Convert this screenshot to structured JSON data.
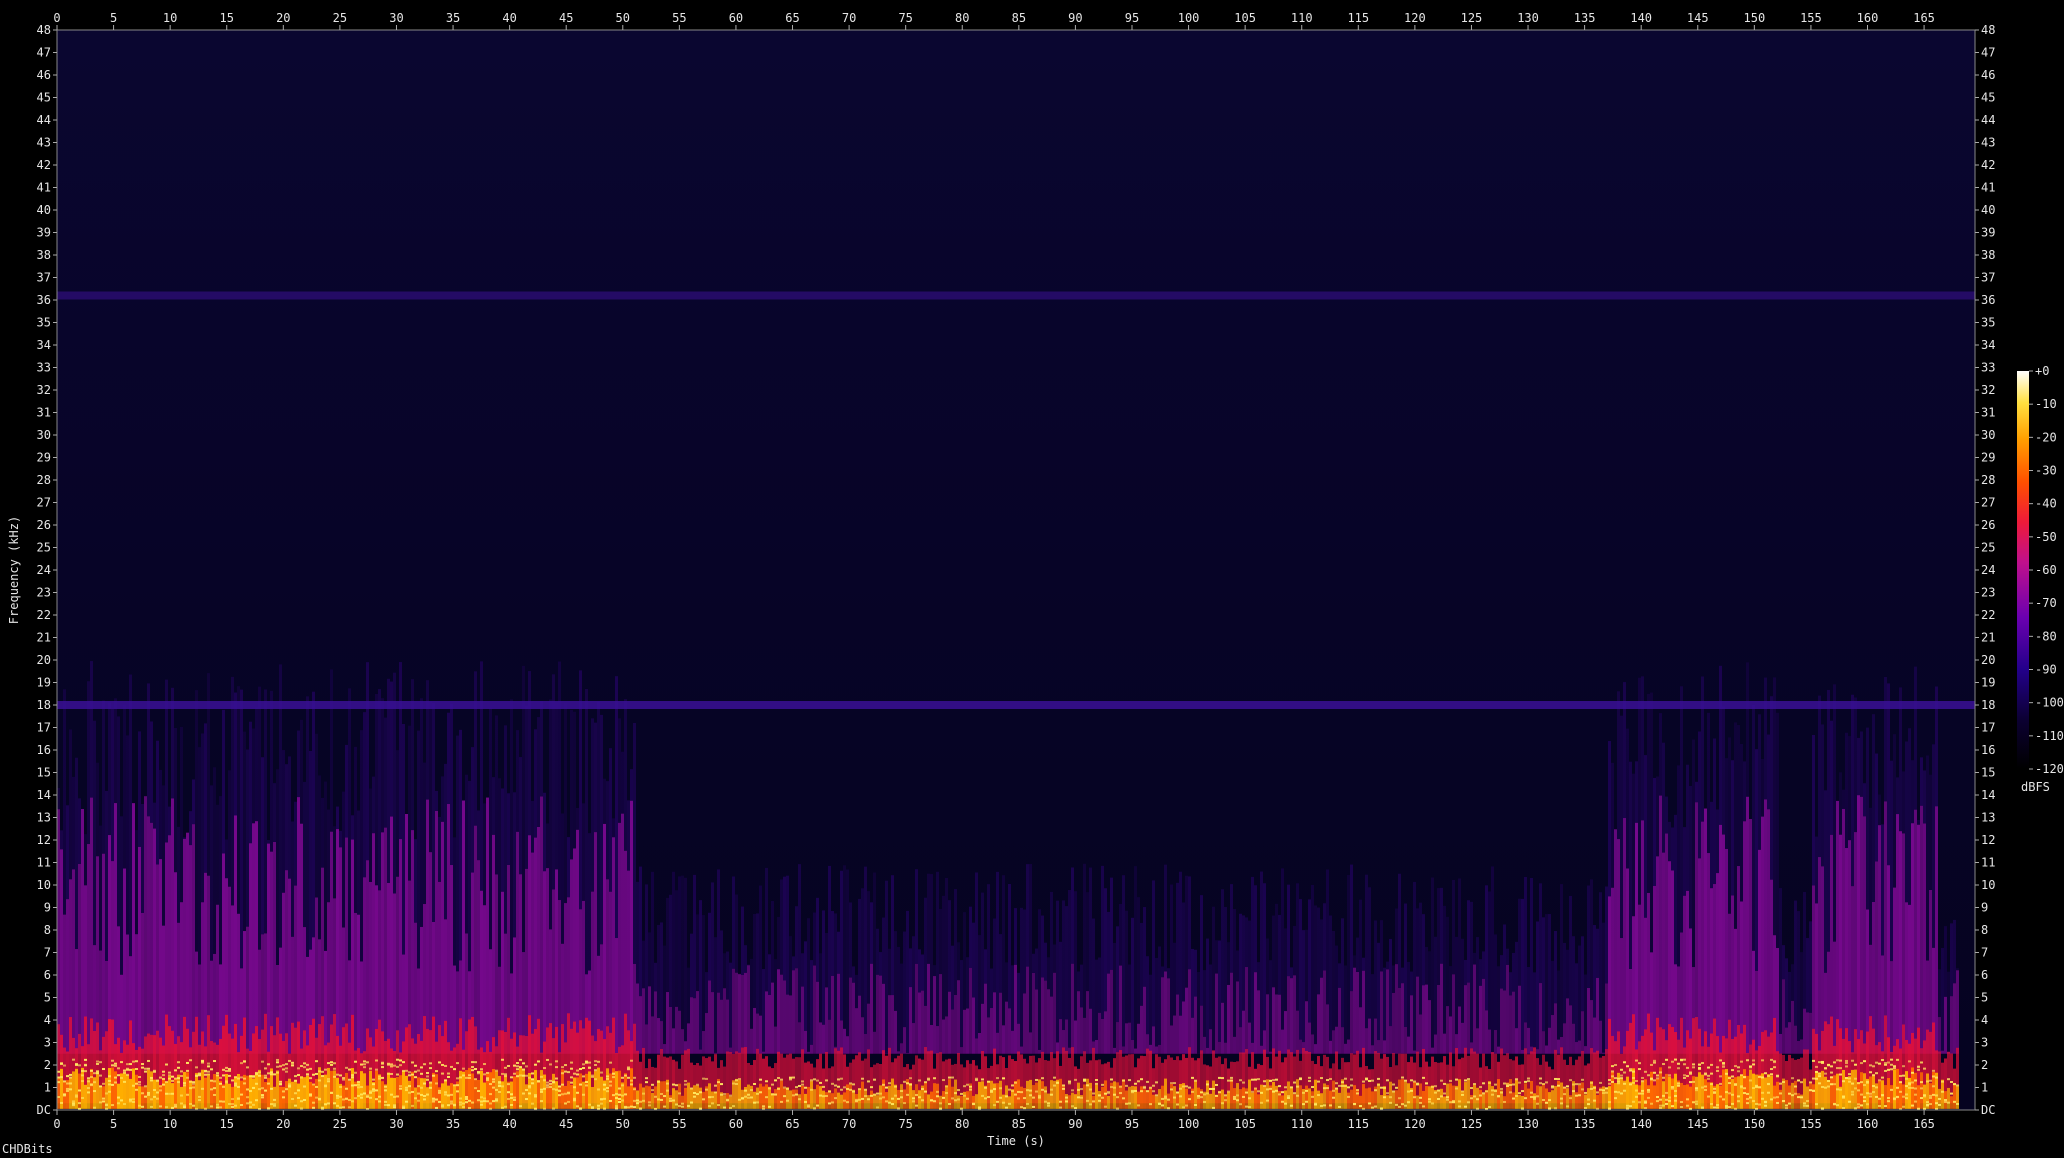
{
  "chart_data": {
    "type": "heatmap",
    "title": "",
    "xlabel": "Time (s)",
    "ylabel": "Frequency (kHz)",
    "xlim": [
      0,
      169.5
    ],
    "ylim": [
      0,
      48
    ],
    "x_ticks": [
      0,
      5,
      10,
      15,
      20,
      25,
      30,
      35,
      40,
      45,
      50,
      55,
      60,
      65,
      70,
      75,
      80,
      85,
      90,
      95,
      100,
      105,
      110,
      115,
      120,
      125,
      130,
      135,
      140,
      145,
      150,
      155,
      160,
      165
    ],
    "y_ticks": [
      "DC",
      "1",
      "2",
      "3",
      "4",
      "5",
      "6",
      "7",
      "8",
      "9",
      "10",
      "11",
      "12",
      "13",
      "14",
      "15",
      "16",
      "17",
      "18",
      "19",
      "20",
      "21",
      "22",
      "23",
      "24",
      "25",
      "26",
      "27",
      "28",
      "29",
      "30",
      "31",
      "32",
      "33",
      "34",
      "35",
      "36",
      "37",
      "38",
      "39",
      "40",
      "41",
      "42",
      "43",
      "44",
      "45",
      "46",
      "47",
      "48"
    ],
    "colorbar": {
      "label": "dBFS",
      "range": [
        -120,
        0
      ],
      "ticks": [
        "+0",
        "-10",
        "-20",
        "-30",
        "-40",
        "-50",
        "-60",
        "-70",
        "-80",
        "-90",
        "-100",
        "-110",
        "-120"
      ]
    },
    "features": {
      "constant_tones_khz": [
        18.0,
        36.2
      ],
      "loud_sections_s": [
        [
          0,
          51
        ],
        [
          137,
          152
        ],
        [
          155,
          166
        ]
      ],
      "quiet_sections_s": [
        [
          51,
          137
        ],
        [
          152,
          155
        ]
      ],
      "signal_end_s": 167
    }
  },
  "footer": {
    "text": "CHDBits"
  }
}
